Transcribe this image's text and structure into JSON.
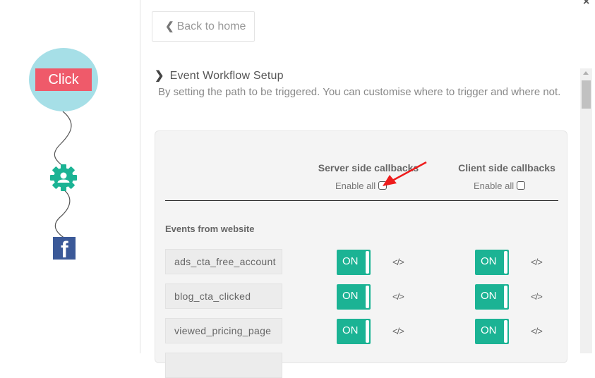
{
  "workflow_diagram": {
    "trigger_label": "Click",
    "nodes": [
      "click-trigger",
      "user-gear",
      "facebook"
    ],
    "colors": {
      "trigger_circle": "#a6dfe7",
      "trigger_label_bg": "#ef5a6a",
      "gear": "#1bb394",
      "facebook": "#3b5998"
    }
  },
  "header": {
    "back_label": "Back to home",
    "close_icon": "×"
  },
  "section": {
    "title": "Event Workflow Setup",
    "description": "By setting the path to be triggered. You can customise where to trigger and where not."
  },
  "table": {
    "columns": [
      {
        "title": "Server side callbacks",
        "enable_all_label": "Enable all",
        "enable_all_checked": false
      },
      {
        "title": "Client side callbacks",
        "enable_all_label": "Enable all",
        "enable_all_checked": false
      }
    ],
    "group_label": "Events from website",
    "toggle_on_label": "ON",
    "code_icon": "</>",
    "rows": [
      {
        "event": "ads_cta_free_account",
        "server": "ON",
        "client": "ON"
      },
      {
        "event": "blog_cta_clicked",
        "server": "ON",
        "client": "ON"
      },
      {
        "event": "viewed_pricing_page",
        "server": "ON",
        "client": "ON"
      }
    ]
  },
  "accent_color": "#1bb394",
  "annotation_arrow_color": "#ee1c1c"
}
